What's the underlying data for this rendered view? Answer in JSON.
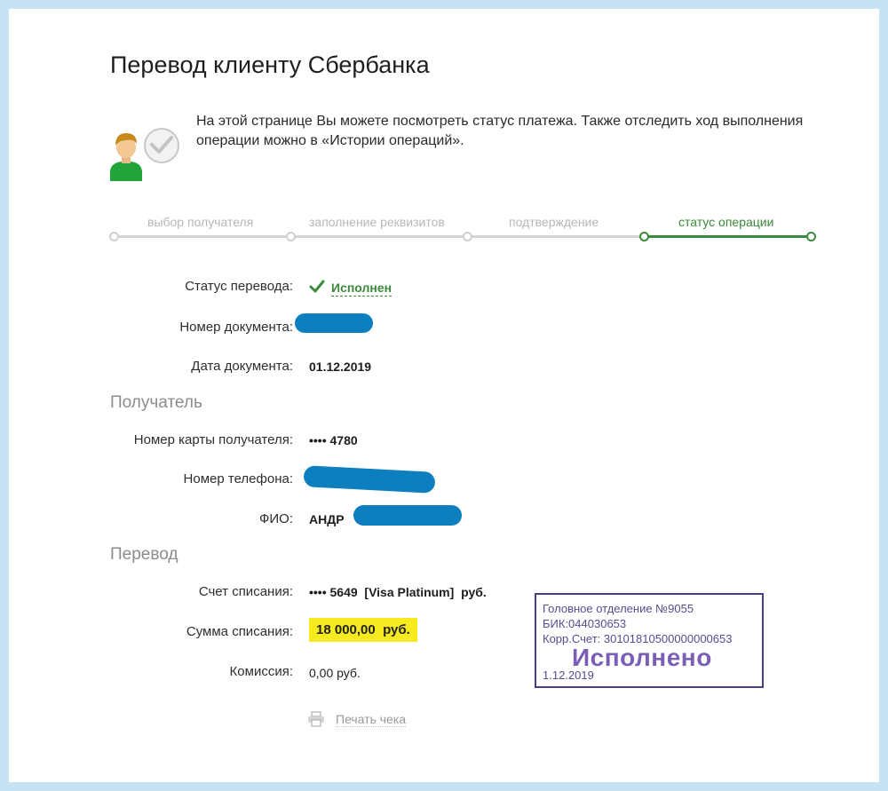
{
  "page": {
    "title": "Перевод клиенту Сбербанка",
    "intro": "На этой странице Вы можете посмотреть статус платежа. Также отследить ход выполнения операции можно в «Истории операций»."
  },
  "steps": [
    {
      "label": "выбор получателя",
      "active": false
    },
    {
      "label": "заполнение реквизитов",
      "active": false
    },
    {
      "label": "подтверждение",
      "active": false
    },
    {
      "label": "статус операции",
      "active": true
    }
  ],
  "details": {
    "status_label": "Статус перевода:",
    "status_value": "Исполнен",
    "doc_number_label": "Номер документа:",
    "doc_date_label": "Дата документа:",
    "doc_date_value": "01.12.2019"
  },
  "recipient": {
    "section_title": "Получатель",
    "card_label": "Номер карты получателя:",
    "card_value": "•••• 4780",
    "phone_label": "Номер телефона:",
    "name_label": "ФИО:",
    "name_value": "АНДР"
  },
  "transfer": {
    "section_title": "Перевод",
    "account_label": "Счет списания:",
    "account_value": "•••• 5649  [Visa Platinum]  руб.",
    "amount_label": "Сумма списания:",
    "amount_value": "18 000,00  руб.",
    "fee_label": "Комиссия:",
    "fee_value": "0,00 руб."
  },
  "print_label": "Печать чека",
  "stamp": {
    "line1": "Головное отделение №9055",
    "line2": "БИК:044030653",
    "line3": "Корр.Счет: 30101810500000000653",
    "status": "Исполнено",
    "date": "1.12.2019"
  },
  "colors": {
    "accent_green": "#3c8a3c",
    "highlight_yellow": "#f7ea1f",
    "stamp_purple": "#4e3c84",
    "redaction_blue": "#0e7fbe",
    "background": "#c6e3f4"
  }
}
